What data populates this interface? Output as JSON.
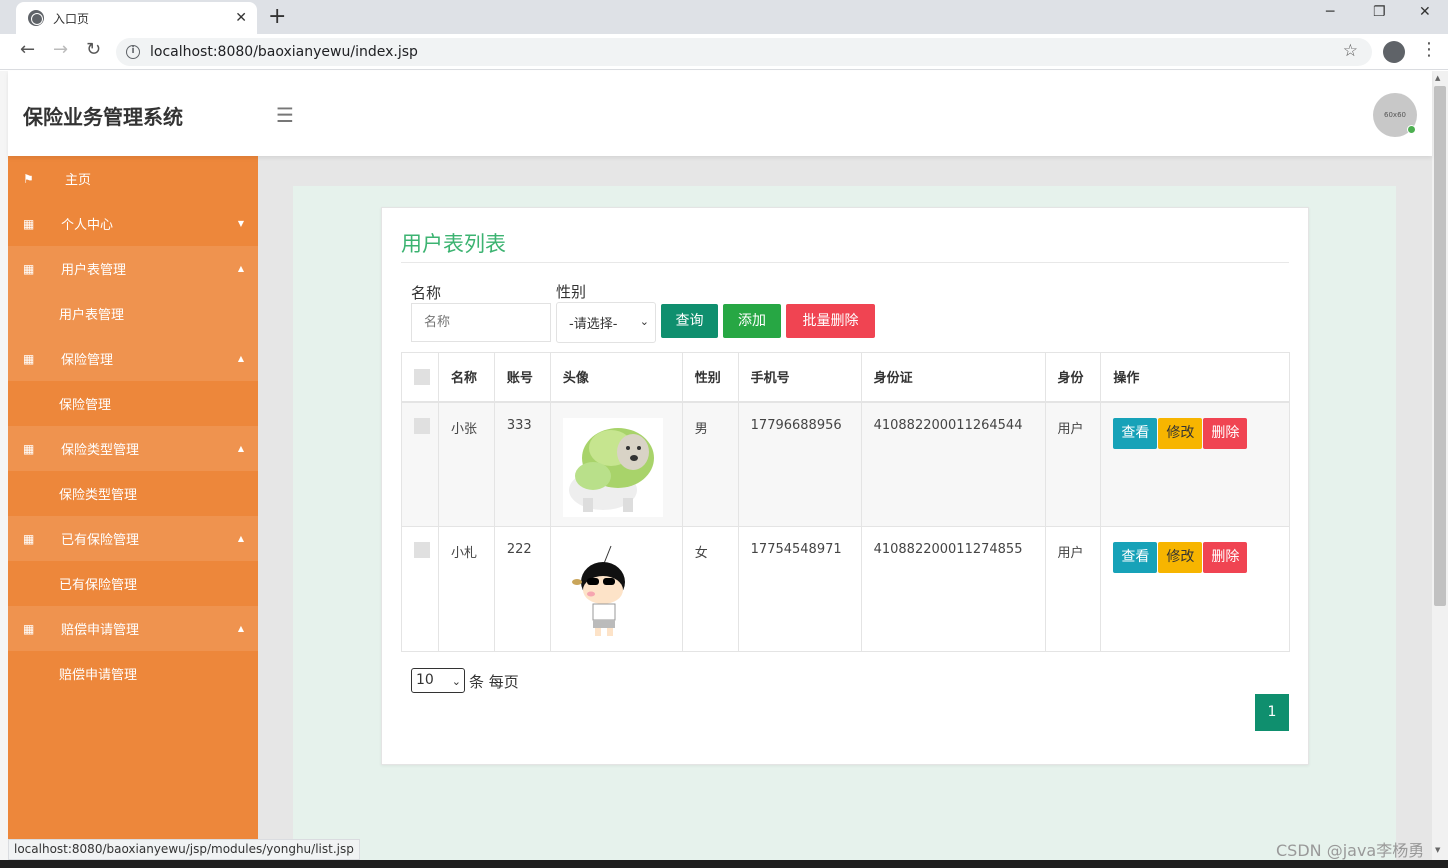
{
  "browser": {
    "tab_title": "入口页",
    "url": "localhost:8080/baoxianyewu/index.jsp",
    "status_url": "localhost:8080/baoxianyewu/jsp/modules/yonghu/list.jsp",
    "new_tab": "+",
    "tab_close": "✕",
    "win_min": "─",
    "win_max": "❐",
    "win_close": "✕"
  },
  "header": {
    "brand": "保险业务管理系统",
    "avatar_text": "60x60"
  },
  "sidebar": {
    "items": [
      {
        "label": "主页",
        "icon": "flag-icon"
      },
      {
        "label": "个人中心",
        "icon": "grid-icon"
      },
      {
        "label": "用户表管理",
        "icon": "grid-icon"
      },
      {
        "label": "用户表管理"
      },
      {
        "label": "保险管理",
        "icon": "grid-icon"
      },
      {
        "label": "保险管理"
      },
      {
        "label": "保险类型管理",
        "icon": "grid-icon"
      },
      {
        "label": "保险类型管理"
      },
      {
        "label": "已有保险管理",
        "icon": "grid-icon"
      },
      {
        "label": "已有保险管理"
      },
      {
        "label": "赔偿申请管理",
        "icon": "grid-icon"
      },
      {
        "label": "赔偿申请管理"
      }
    ]
  },
  "main": {
    "title": "用户表列表",
    "filters": {
      "name_label": "名称",
      "name_placeholder": "名称",
      "gender_label": "性别",
      "gender_value": "-请选择-"
    },
    "buttons": {
      "query": "查询",
      "add": "添加",
      "bulk_delete": "批量删除"
    },
    "table": {
      "headers": [
        "名称",
        "账号",
        "头像",
        "性别",
        "手机号",
        "身份证",
        "身份",
        "操作"
      ],
      "rows": [
        {
          "name": "小张",
          "account": "333",
          "gender": "男",
          "phone": "17796688956",
          "id_card": "410882200011264544",
          "role": "用户"
        },
        {
          "name": "小札",
          "account": "222",
          "gender": "女",
          "phone": "17754548971",
          "id_card": "410882200011274855",
          "role": "用户"
        }
      ],
      "actions": {
        "view": "查看",
        "edit": "修改",
        "delete": "删除"
      }
    },
    "pager": {
      "page_size": "10",
      "per_page_text": "条 每页",
      "current_page": "1"
    }
  },
  "watermark": "CSDN @java李杨勇",
  "colors": {
    "sidebar": "#ed873b",
    "title": "#3cb371",
    "query": "#0f8f6e",
    "add": "#27a744",
    "delete": "#f04452",
    "view": "#17a2b8",
    "edit": "#f7b500"
  }
}
